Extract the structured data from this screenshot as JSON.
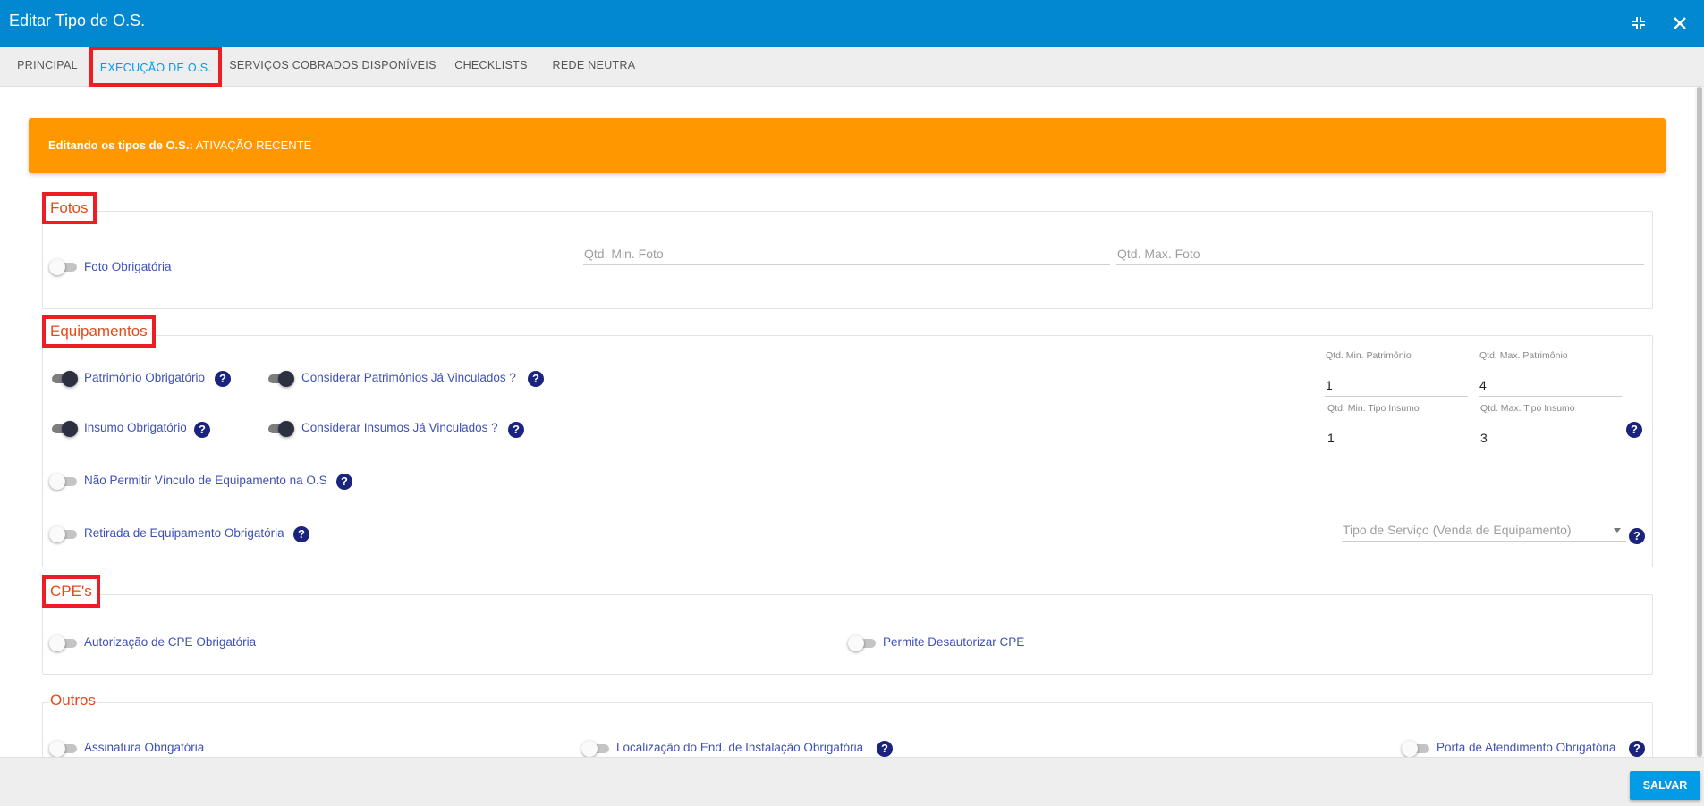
{
  "window": {
    "title": "Editar Tipo de O.S."
  },
  "tabs": [
    {
      "label": "PRINCIPAL"
    },
    {
      "label": "EXECUÇÃO DE O.S."
    },
    {
      "label": "SERVIÇOS COBRADOS DISPONÍVEIS"
    },
    {
      "label": "CHECKLISTS"
    },
    {
      "label": "REDE NEUTRA"
    }
  ],
  "active_tab": "EXECUÇÃO DE O.S.",
  "alert": {
    "prefix": "Editando os tipos de O.S.:",
    "value": "ATIVAÇÃO RECENTE",
    "color": "#ff9800"
  },
  "fotos": {
    "legend": "Fotos",
    "foto_obrigatoria": {
      "label": "Foto Obrigatória",
      "on": false
    },
    "qtd_min": {
      "placeholder": "Qtd. Min. Foto",
      "value": ""
    },
    "qtd_max": {
      "placeholder": "Qtd. Max. Foto",
      "value": ""
    }
  },
  "equipamentos": {
    "legend": "Equipamentos",
    "patrimonio_obrigatorio": {
      "label": "Patrimônio Obrigatório",
      "on": true
    },
    "considerar_patrimonios": {
      "label": "Considerar Patrimônios Já Vinculados ?",
      "on": true
    },
    "insumo_obrigatorio": {
      "label": "Insumo Obrigatório",
      "on": true
    },
    "considerar_insumos": {
      "label": "Considerar Insumos Já Vinculados ?",
      "on": true
    },
    "nao_permitir_vinculo": {
      "label": "Não Permitir Vínculo de Equipamento na O.S",
      "on": false
    },
    "retirada_equipamento": {
      "label": "Retirada de Equipamento Obrigatória",
      "on": false
    },
    "qtd_min_patrimonio": {
      "label": "Qtd. Min. Patrimônio",
      "value": "1"
    },
    "qtd_max_patrimonio": {
      "label": "Qtd. Max. Patrimônio",
      "value": "4"
    },
    "qtd_min_tipo_insumo": {
      "label": "Qtd. Min. Tipo Insumo",
      "value": "1"
    },
    "qtd_max_tipo_insumo": {
      "label": "Qtd. Max. Tipo Insumo",
      "value": "3"
    },
    "tipo_servico": {
      "placeholder": "Tipo de Serviço (Venda de Equipamento)"
    }
  },
  "cpes": {
    "legend": "CPE's",
    "autorizacao_cpe": {
      "label": "Autorização de CPE Obrigatória",
      "on": false
    },
    "permite_desautorizar": {
      "label": "Permite Desautorizar CPE",
      "on": false
    }
  },
  "outros": {
    "legend": "Outros",
    "assinatura": {
      "label": "Assinatura Obrigatória",
      "on": false
    },
    "localizacao": {
      "label": "Localização do End. de Instalação Obrigatória",
      "on": false
    },
    "porta_atendimento": {
      "label": "Porta de Atendimento Obrigatória",
      "on": false
    }
  },
  "help_glyph": "?",
  "footer": {
    "save_label": "SALVAR"
  },
  "colors": {
    "header": "#0288d1",
    "accent": "#039be5",
    "legend": "#e64a19",
    "label": "#3f51b5",
    "highlight_box": "#ee1c25"
  }
}
